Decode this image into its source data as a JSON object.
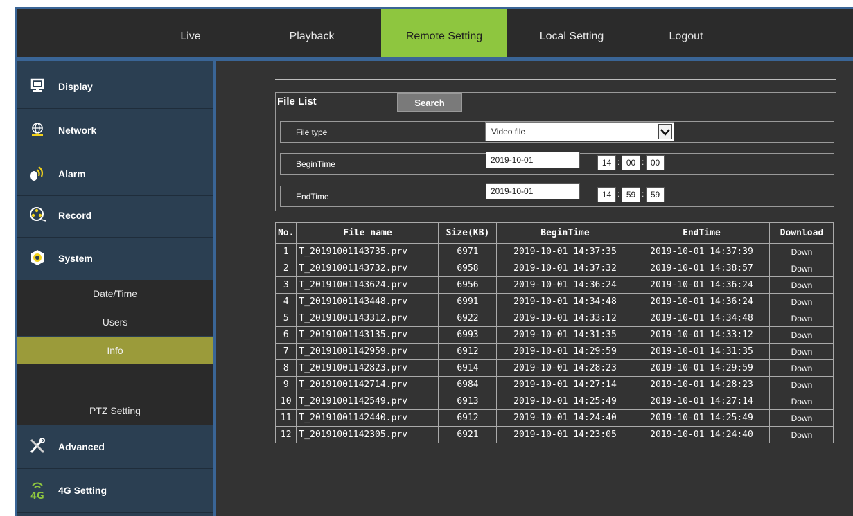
{
  "topnav": {
    "items": [
      {
        "label": "Live"
      },
      {
        "label": "Playback"
      },
      {
        "label": "Remote Setting",
        "active": true
      },
      {
        "label": "Local Setting"
      },
      {
        "label": "Logout"
      }
    ]
  },
  "sidebar": {
    "items": [
      {
        "label": "Display",
        "icon": "monitor-icon"
      },
      {
        "label": "Network",
        "icon": "globe-icon"
      },
      {
        "label": "Alarm",
        "icon": "alarm-icon"
      },
      {
        "label": "Record",
        "icon": "film-reel-icon"
      },
      {
        "label": "System",
        "icon": "gear-nut-icon"
      }
    ],
    "system_sub": [
      {
        "label": "Date/Time"
      },
      {
        "label": "Users"
      },
      {
        "label": "Info",
        "active": true
      },
      {
        "label": ""
      },
      {
        "label": "PTZ Setting"
      }
    ],
    "bottom_items": [
      {
        "label": "Advanced",
        "icon": "tools-icon"
      },
      {
        "label": "4G Setting",
        "icon": "4g-signal-icon"
      }
    ]
  },
  "filelist": {
    "title": "File List",
    "search_label": "Search",
    "file_type_label": "File type",
    "file_type_value": "Video file",
    "begin_label": "BeginTime",
    "begin_date": "2019-10-01",
    "begin_h": "14",
    "begin_m": "00",
    "begin_s": "00",
    "end_label": "EndTime",
    "end_date": "2019-10-01",
    "end_h": "14",
    "end_m": "59",
    "end_s": "59"
  },
  "table": {
    "headers": [
      "No.",
      "File name",
      "Size(KB)",
      "BeginTime",
      "EndTime",
      "Download"
    ],
    "rows": [
      [
        "1",
        "T_20191001143735.prv",
        "6971",
        "2019-10-01 14:37:35",
        "2019-10-01 14:37:39",
        "Down"
      ],
      [
        "2",
        "T_20191001143732.prv",
        "6958",
        "2019-10-01 14:37:32",
        "2019-10-01 14:38:57",
        "Down"
      ],
      [
        "3",
        "T_20191001143624.prv",
        "6956",
        "2019-10-01 14:36:24",
        "2019-10-01 14:36:24",
        "Down"
      ],
      [
        "4",
        "T_20191001143448.prv",
        "6991",
        "2019-10-01 14:34:48",
        "2019-10-01 14:36:24",
        "Down"
      ],
      [
        "5",
        "T_20191001143312.prv",
        "6922",
        "2019-10-01 14:33:12",
        "2019-10-01 14:34:48",
        "Down"
      ],
      [
        "6",
        "T_20191001143135.prv",
        "6993",
        "2019-10-01 14:31:35",
        "2019-10-01 14:33:12",
        "Down"
      ],
      [
        "7",
        "T_20191001142959.prv",
        "6912",
        "2019-10-01 14:29:59",
        "2019-10-01 14:31:35",
        "Down"
      ],
      [
        "8",
        "T_20191001142823.prv",
        "6914",
        "2019-10-01 14:28:23",
        "2019-10-01 14:29:59",
        "Down"
      ],
      [
        "9",
        "T_20191001142714.prv",
        "6984",
        "2019-10-01 14:27:14",
        "2019-10-01 14:28:23",
        "Down"
      ],
      [
        "10",
        "T_20191001142549.prv",
        "6913",
        "2019-10-01 14:25:49",
        "2019-10-01 14:27:14",
        "Down"
      ],
      [
        "11",
        "T_20191001142440.prv",
        "6912",
        "2019-10-01 14:24:40",
        "2019-10-01 14:25:49",
        "Down"
      ],
      [
        "12",
        "T_20191001142305.prv",
        "6921",
        "2019-10-01 14:23:05",
        "2019-10-01 14:24:40",
        "Down"
      ]
    ]
  },
  "colors": {
    "nav_bg": "#2b2b2b",
    "nav_active": "#8ec63f",
    "sidebar_bg": "#2b3f52",
    "sub_active": "#9b9b3a",
    "frame_blue": "#3a6596",
    "content_bg": "#333333"
  }
}
